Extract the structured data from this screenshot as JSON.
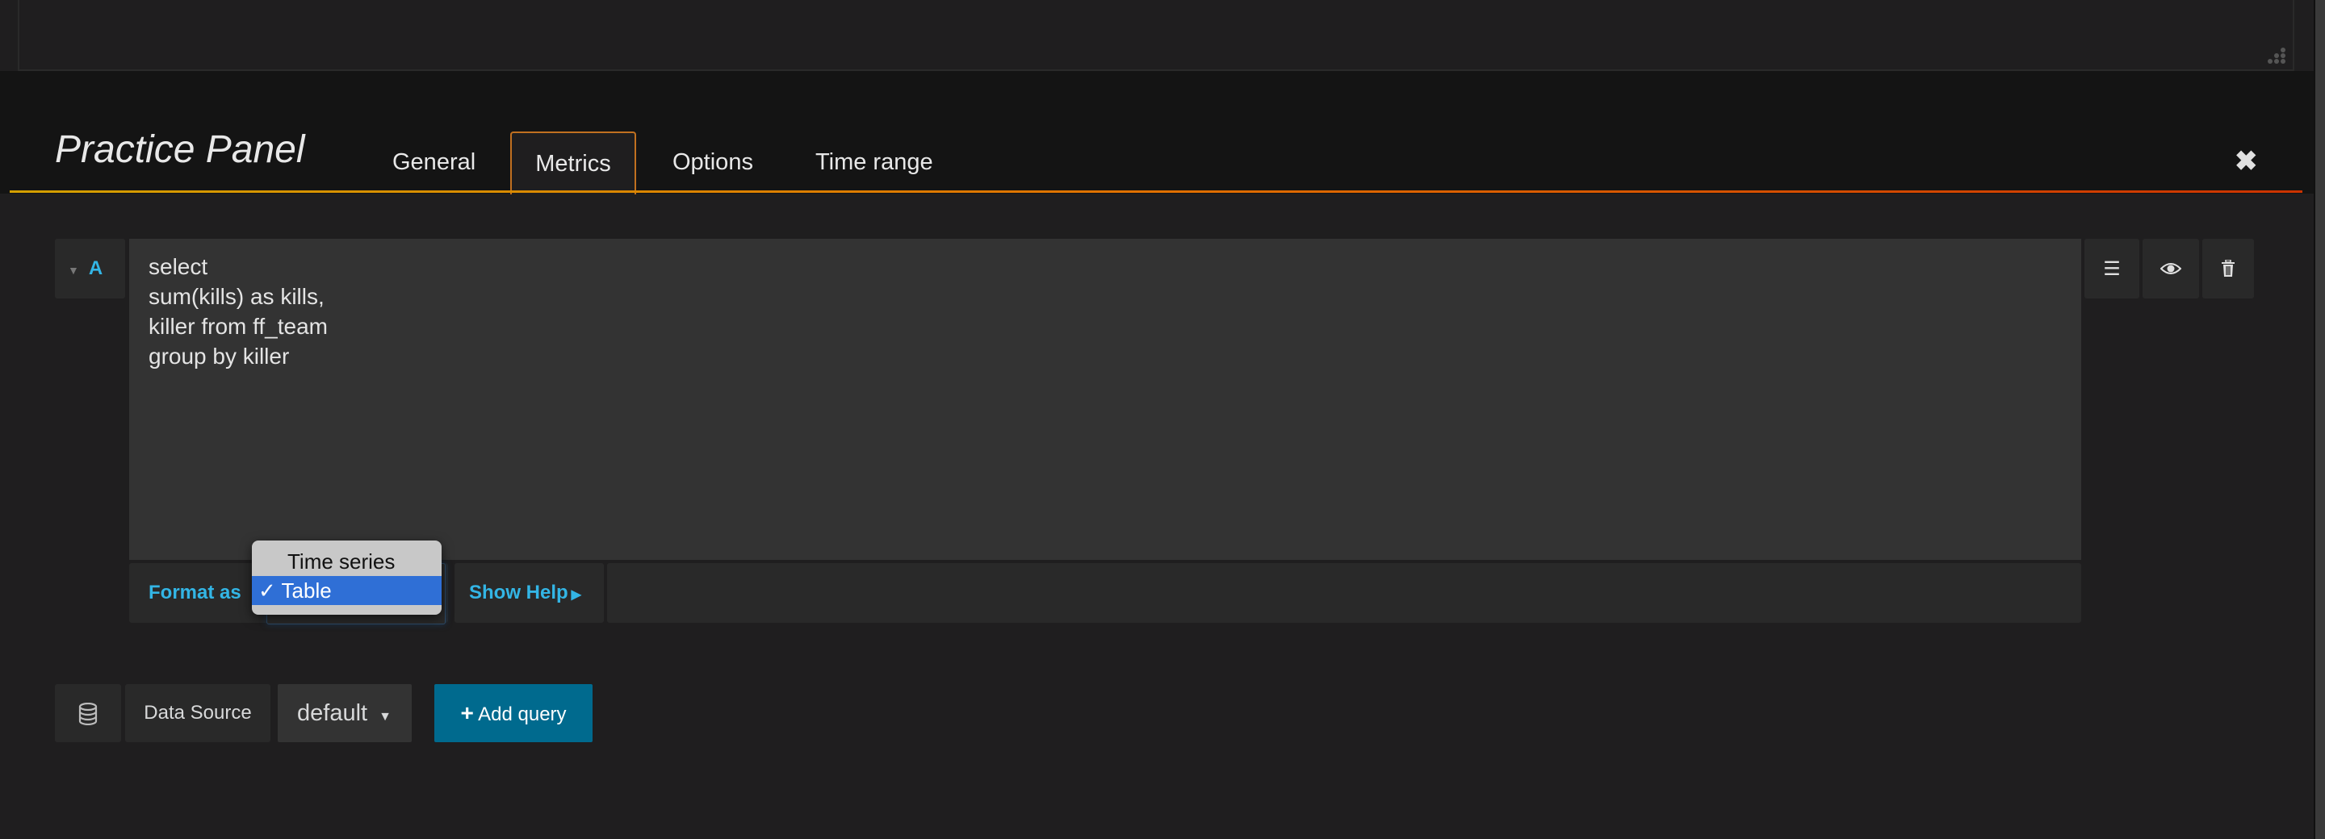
{
  "panel": {
    "title": "Practice Panel"
  },
  "tabs": [
    {
      "label": "General"
    },
    {
      "label": "Metrics",
      "active": true
    },
    {
      "label": "Options"
    },
    {
      "label": "Time range"
    }
  ],
  "query": {
    "ref_id": "A",
    "sql": "select\nsum(kills) as kills,\nkiller from ff_team\ngroup by killer",
    "format_label": "Format as",
    "format_options": [
      "Time series",
      "Table"
    ],
    "format_selected": "Table",
    "show_help": "Show Help"
  },
  "datasource": {
    "label": "Data Source",
    "value": "default"
  },
  "add_query": "Add query",
  "colors": {
    "accent": "#33b5e5",
    "add_button": "#006a8e",
    "tab_border": "#c07020",
    "selected_option": "#2f6fd6"
  }
}
